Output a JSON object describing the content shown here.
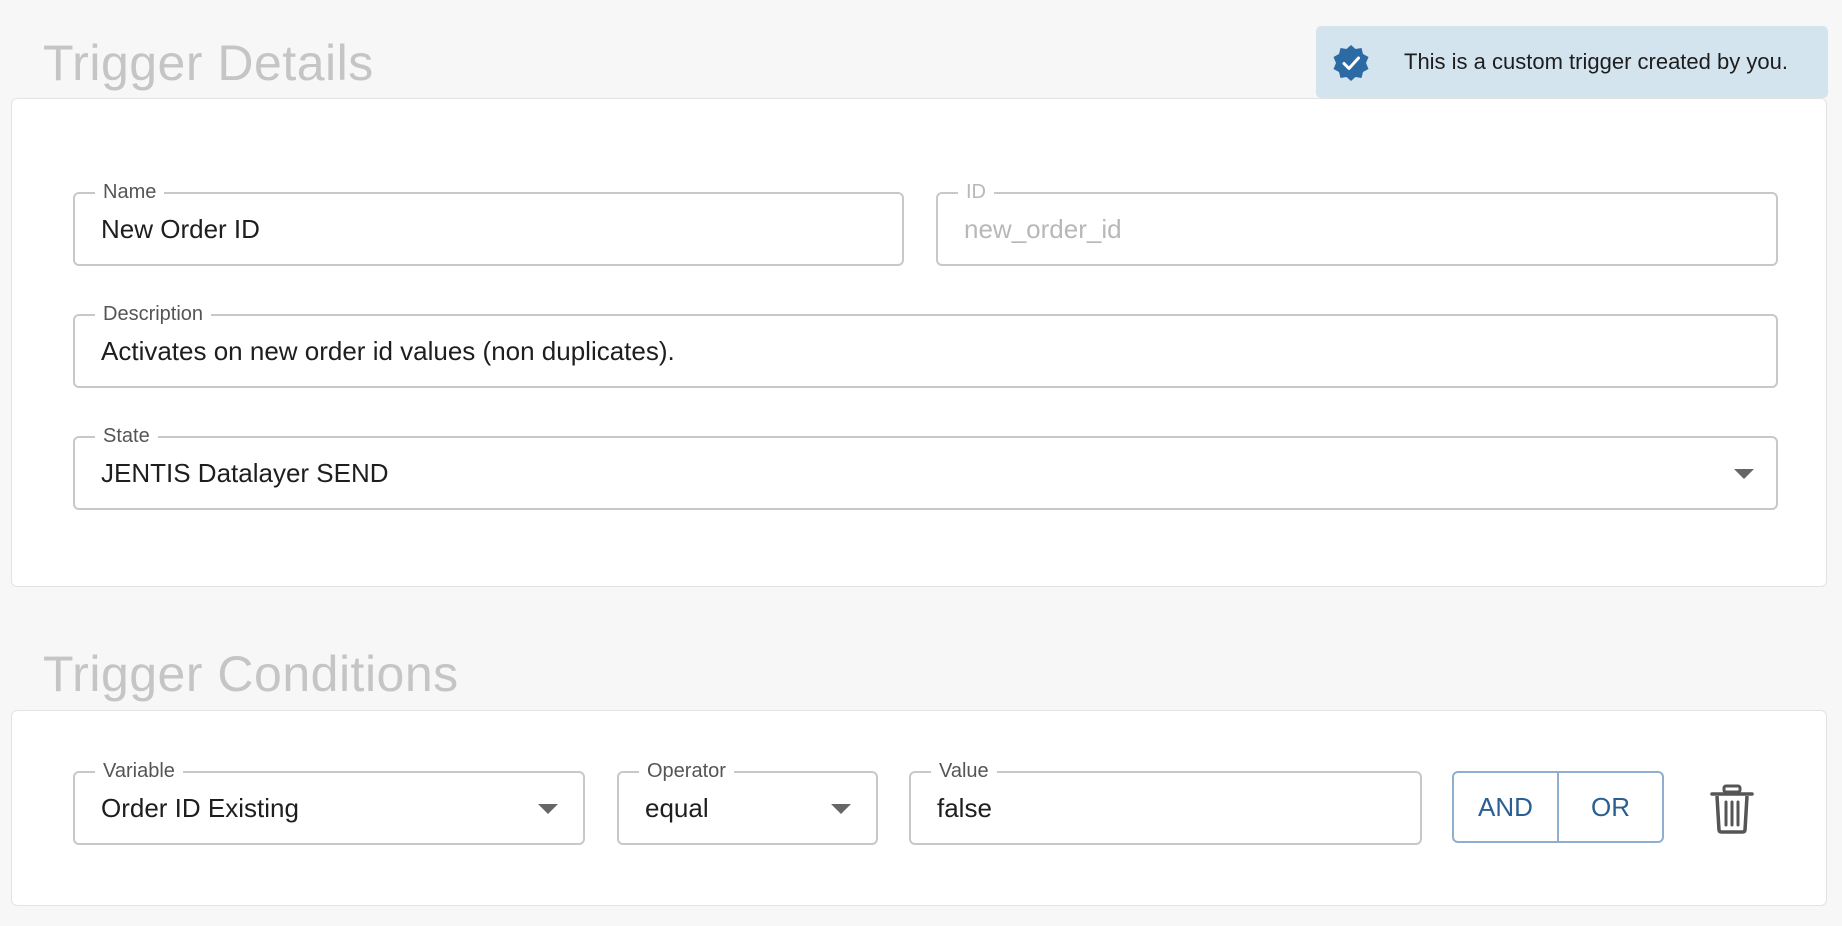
{
  "details": {
    "title": "Trigger Details",
    "toast": {
      "message": "This is a custom trigger created by you.",
      "icon": "check-badge-icon"
    },
    "name": {
      "label": "Name",
      "value": "New Order ID"
    },
    "id": {
      "label": "ID",
      "value": "new_order_id"
    },
    "description": {
      "label": "Description",
      "value": "Activates on new order id values (non duplicates)."
    },
    "state": {
      "label": "State",
      "value": "JENTIS Datalayer SEND"
    }
  },
  "conditions": {
    "title": "Trigger Conditions",
    "variable": {
      "label": "Variable",
      "value": "Order ID Existing"
    },
    "operator": {
      "label": "Operator",
      "value": "equal"
    },
    "value": {
      "label": "Value",
      "value": "false"
    },
    "and_label": "AND",
    "or_label": "OR",
    "delete_icon": "trash-icon"
  },
  "colors": {
    "accent": "#2b6aa3",
    "toast_bg": "#d4e4ef",
    "button_border": "#8eafcf",
    "heading": "#c5c5c5"
  }
}
